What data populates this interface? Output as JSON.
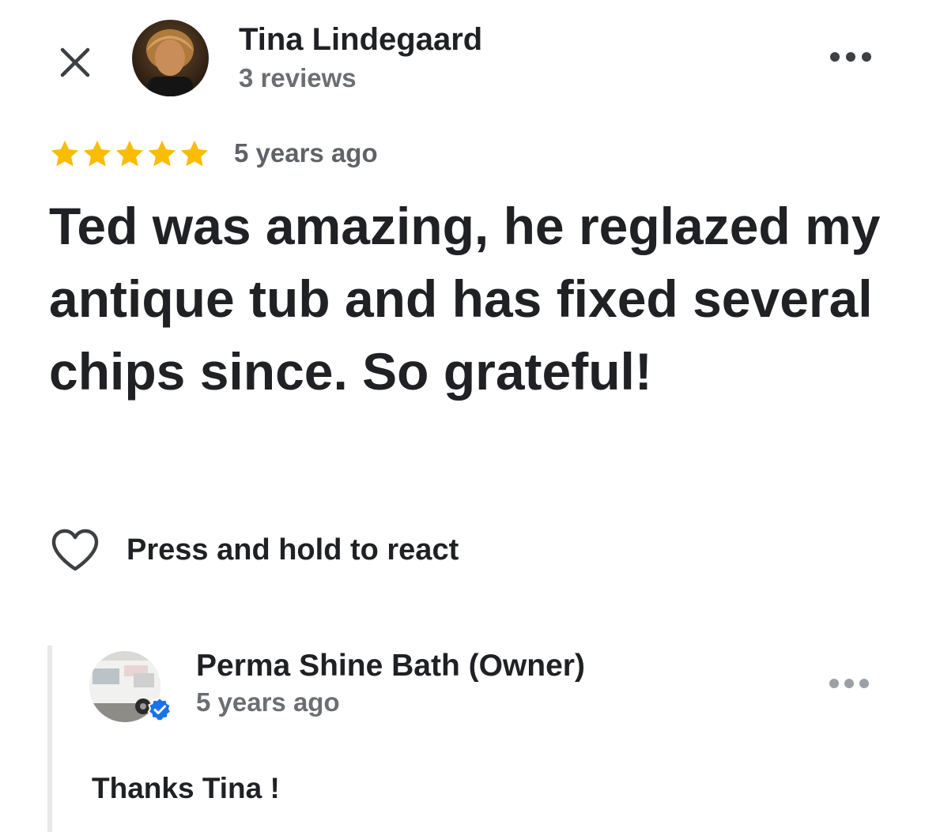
{
  "review": {
    "reviewer_name": "Tina Lindegaard",
    "reviewer_review_count": "3 reviews",
    "rating": 5,
    "rating_max": 5,
    "date": "5 years ago",
    "text": "Ted was amazing, he reglazed my antique tub and has fixed several chips since. So grateful!",
    "react_label": "Press and hold to react"
  },
  "owner_reply": {
    "name": "Perma Shine Bath (Owner)",
    "date": "5 years ago",
    "text": "Thanks Tina !"
  },
  "icons": {
    "close": "close-icon",
    "more": "more-horizontal-icon",
    "star": "star-icon",
    "heart": "heart-outline-icon",
    "verified": "verified-check-icon"
  },
  "colors": {
    "star": "#fbbc04",
    "verified": "#1a73e8",
    "text_primary": "#202124",
    "text_secondary": "#6b6e72"
  }
}
